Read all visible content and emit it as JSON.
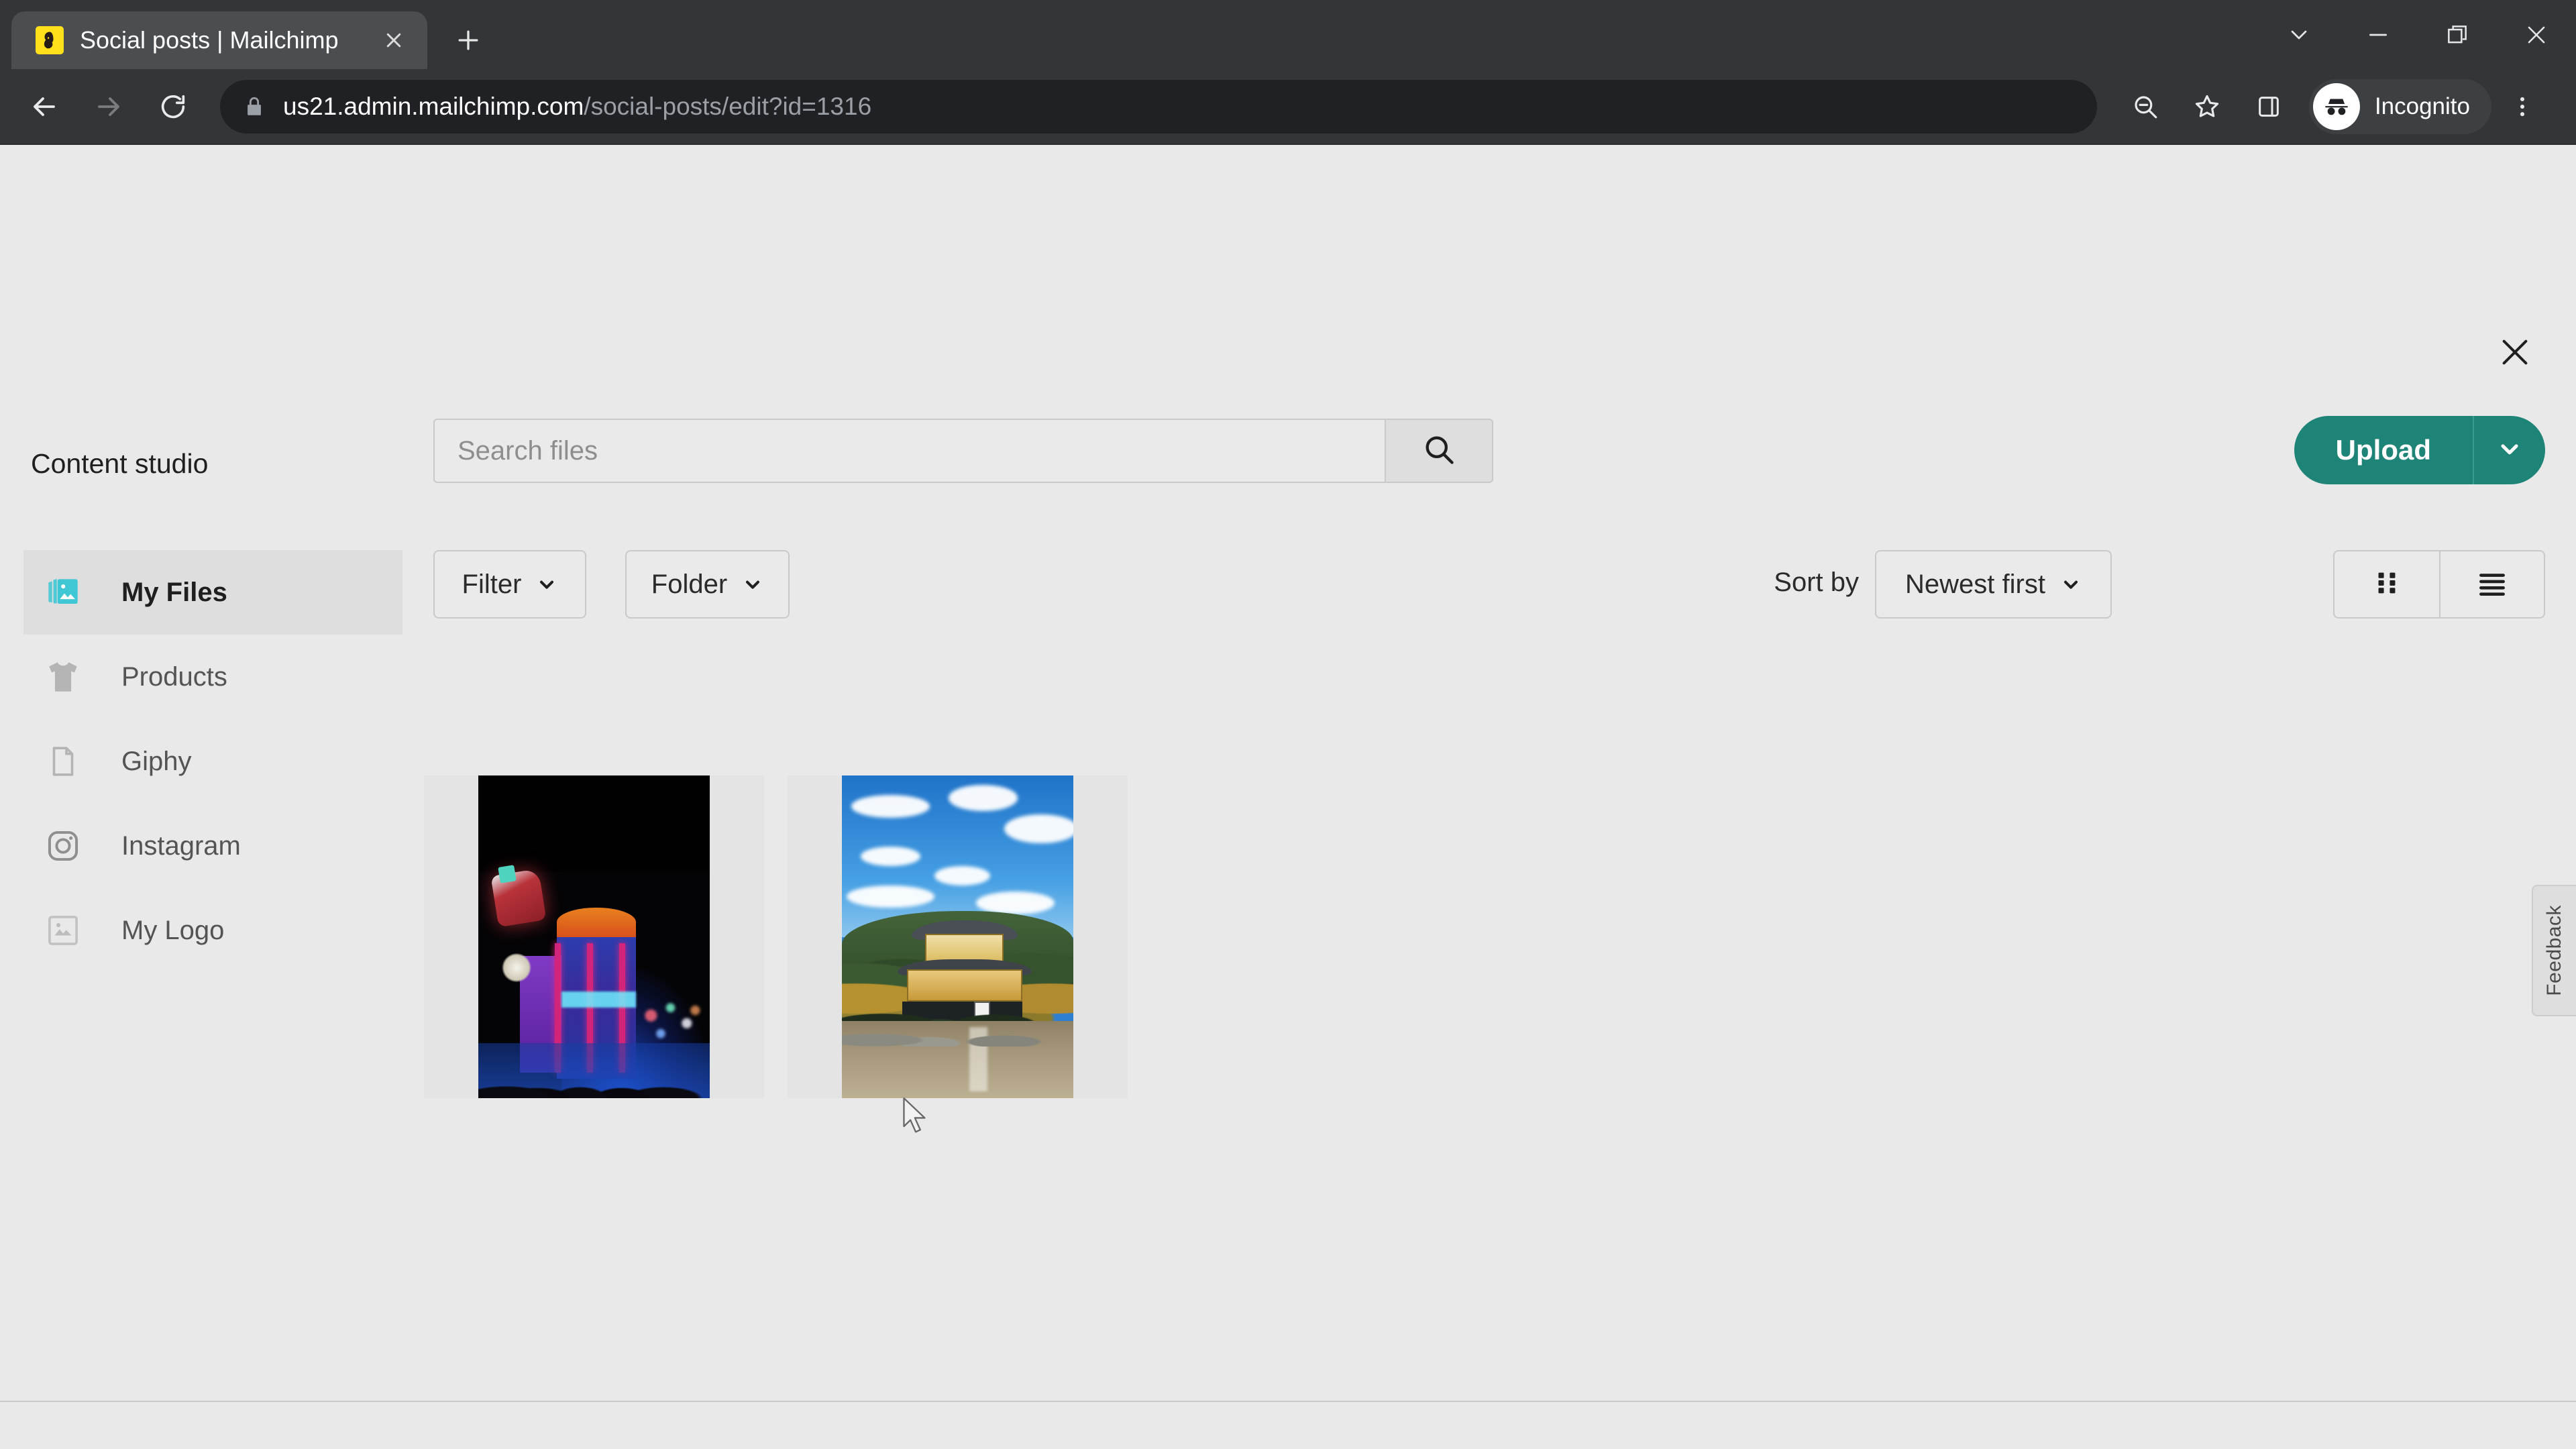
{
  "browser": {
    "tab": {
      "title": "Social posts | Mailchimp",
      "favicon_icon": "mailchimp-favicon",
      "close_icon": "close-icon"
    },
    "new_tab_label": "+",
    "window_controls": [
      {
        "name": "tab-search-button",
        "icon": "chevron-down-icon"
      },
      {
        "name": "minimize-button",
        "icon": "minimize-icon"
      },
      {
        "name": "restore-button",
        "icon": "restore-icon"
      },
      {
        "name": "close-window-button",
        "icon": "close-icon"
      }
    ],
    "nav": {
      "back_icon": "back-arrow-icon",
      "forward_icon": "forward-arrow-icon",
      "reload_icon": "reload-icon"
    },
    "omnibox": {
      "lock_icon": "lock-icon",
      "url_host": "us21.admin.mailchimp.com",
      "url_path": "/social-posts/edit?id=1316"
    },
    "toolbar_icons": [
      {
        "name": "zoom-out-icon",
        "label": "zoom-out"
      },
      {
        "name": "bookmark-star-icon",
        "label": "bookmark"
      },
      {
        "name": "side-panel-icon",
        "label": "side-panel"
      }
    ],
    "profile": {
      "name": "Incognito",
      "avatar_icon": "incognito-avatar-icon"
    },
    "menu_icon": "three-dot-menu-icon"
  },
  "modal": {
    "close_icon": "close-icon",
    "title": "Content studio"
  },
  "search": {
    "placeholder": "Search files",
    "value": "",
    "button_icon": "search-icon"
  },
  "upload": {
    "label": "Upload",
    "caret_icon": "chevron-down-icon"
  },
  "sidebar": {
    "items": [
      {
        "label": "My Files",
        "icon": "images-icon",
        "active": true
      },
      {
        "label": "Products",
        "icon": "tshirt-icon",
        "active": false
      },
      {
        "label": "Giphy",
        "icon": "file-icon",
        "active": false
      },
      {
        "label": "Instagram",
        "icon": "instagram-icon",
        "active": false
      },
      {
        "label": "My Logo",
        "icon": "image-frame-icon",
        "active": false
      }
    ]
  },
  "toolbar": {
    "filter_label": "Filter",
    "folder_label": "Folder",
    "sort_by_label": "Sort by",
    "sort_value": "Newest first",
    "grid_view_icon": "grid-view-icon",
    "list_view_icon": "list-view-icon",
    "caret_icon": "chevron-down-icon"
  },
  "files": [
    {
      "name": "citywalk-night-thumbnail",
      "alt": "Neon Coca-Cola sign and CITYWALK building at night"
    },
    {
      "name": "golden-pavilion-thumbnail",
      "alt": "Kinkaku-ji golden pavilion beside a pond under blue sky"
    }
  ],
  "feedback": {
    "label": "Feedback"
  },
  "colors": {
    "accent_teal": "#1f8478",
    "active_icon_teal": "#3fc7d4",
    "chrome_dark": "#323639",
    "page_bg": "#e9e9e9"
  }
}
